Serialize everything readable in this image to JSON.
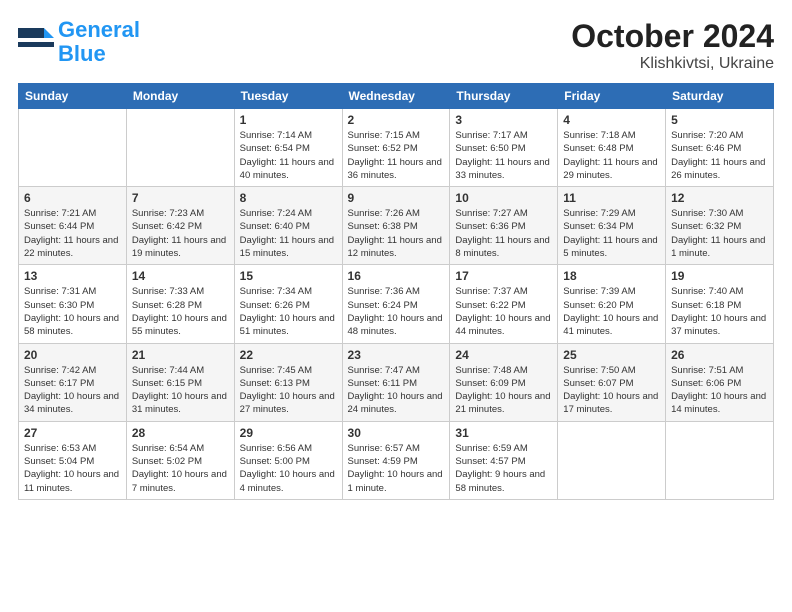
{
  "header": {
    "logo_line1": "General",
    "logo_line2": "Blue",
    "month": "October 2024",
    "location": "Klishkivtsi, Ukraine"
  },
  "weekdays": [
    "Sunday",
    "Monday",
    "Tuesday",
    "Wednesday",
    "Thursday",
    "Friday",
    "Saturday"
  ],
  "weeks": [
    [
      {
        "day": null
      },
      {
        "day": null
      },
      {
        "day": "1",
        "sunrise": "7:14 AM",
        "sunset": "6:54 PM",
        "daylight": "11 hours and 40 minutes."
      },
      {
        "day": "2",
        "sunrise": "7:15 AM",
        "sunset": "6:52 PM",
        "daylight": "11 hours and 36 minutes."
      },
      {
        "day": "3",
        "sunrise": "7:17 AM",
        "sunset": "6:50 PM",
        "daylight": "11 hours and 33 minutes."
      },
      {
        "day": "4",
        "sunrise": "7:18 AM",
        "sunset": "6:48 PM",
        "daylight": "11 hours and 29 minutes."
      },
      {
        "day": "5",
        "sunrise": "7:20 AM",
        "sunset": "6:46 PM",
        "daylight": "11 hours and 26 minutes."
      }
    ],
    [
      {
        "day": "6",
        "sunrise": "7:21 AM",
        "sunset": "6:44 PM",
        "daylight": "11 hours and 22 minutes."
      },
      {
        "day": "7",
        "sunrise": "7:23 AM",
        "sunset": "6:42 PM",
        "daylight": "11 hours and 19 minutes."
      },
      {
        "day": "8",
        "sunrise": "7:24 AM",
        "sunset": "6:40 PM",
        "daylight": "11 hours and 15 minutes."
      },
      {
        "day": "9",
        "sunrise": "7:26 AM",
        "sunset": "6:38 PM",
        "daylight": "11 hours and 12 minutes."
      },
      {
        "day": "10",
        "sunrise": "7:27 AM",
        "sunset": "6:36 PM",
        "daylight": "11 hours and 8 minutes."
      },
      {
        "day": "11",
        "sunrise": "7:29 AM",
        "sunset": "6:34 PM",
        "daylight": "11 hours and 5 minutes."
      },
      {
        "day": "12",
        "sunrise": "7:30 AM",
        "sunset": "6:32 PM",
        "daylight": "11 hours and 1 minute."
      }
    ],
    [
      {
        "day": "13",
        "sunrise": "7:31 AM",
        "sunset": "6:30 PM",
        "daylight": "10 hours and 58 minutes."
      },
      {
        "day": "14",
        "sunrise": "7:33 AM",
        "sunset": "6:28 PM",
        "daylight": "10 hours and 55 minutes."
      },
      {
        "day": "15",
        "sunrise": "7:34 AM",
        "sunset": "6:26 PM",
        "daylight": "10 hours and 51 minutes."
      },
      {
        "day": "16",
        "sunrise": "7:36 AM",
        "sunset": "6:24 PM",
        "daylight": "10 hours and 48 minutes."
      },
      {
        "day": "17",
        "sunrise": "7:37 AM",
        "sunset": "6:22 PM",
        "daylight": "10 hours and 44 minutes."
      },
      {
        "day": "18",
        "sunrise": "7:39 AM",
        "sunset": "6:20 PM",
        "daylight": "10 hours and 41 minutes."
      },
      {
        "day": "19",
        "sunrise": "7:40 AM",
        "sunset": "6:18 PM",
        "daylight": "10 hours and 37 minutes."
      }
    ],
    [
      {
        "day": "20",
        "sunrise": "7:42 AM",
        "sunset": "6:17 PM",
        "daylight": "10 hours and 34 minutes."
      },
      {
        "day": "21",
        "sunrise": "7:44 AM",
        "sunset": "6:15 PM",
        "daylight": "10 hours and 31 minutes."
      },
      {
        "day": "22",
        "sunrise": "7:45 AM",
        "sunset": "6:13 PM",
        "daylight": "10 hours and 27 minutes."
      },
      {
        "day": "23",
        "sunrise": "7:47 AM",
        "sunset": "6:11 PM",
        "daylight": "10 hours and 24 minutes."
      },
      {
        "day": "24",
        "sunrise": "7:48 AM",
        "sunset": "6:09 PM",
        "daylight": "10 hours and 21 minutes."
      },
      {
        "day": "25",
        "sunrise": "7:50 AM",
        "sunset": "6:07 PM",
        "daylight": "10 hours and 17 minutes."
      },
      {
        "day": "26",
        "sunrise": "7:51 AM",
        "sunset": "6:06 PM",
        "daylight": "10 hours and 14 minutes."
      }
    ],
    [
      {
        "day": "27",
        "sunrise": "6:53 AM",
        "sunset": "5:04 PM",
        "daylight": "10 hours and 11 minutes."
      },
      {
        "day": "28",
        "sunrise": "6:54 AM",
        "sunset": "5:02 PM",
        "daylight": "10 hours and 7 minutes."
      },
      {
        "day": "29",
        "sunrise": "6:56 AM",
        "sunset": "5:00 PM",
        "daylight": "10 hours and 4 minutes."
      },
      {
        "day": "30",
        "sunrise": "6:57 AM",
        "sunset": "4:59 PM",
        "daylight": "10 hours and 1 minute."
      },
      {
        "day": "31",
        "sunrise": "6:59 AM",
        "sunset": "4:57 PM",
        "daylight": "9 hours and 58 minutes."
      },
      {
        "day": null
      },
      {
        "day": null
      }
    ]
  ]
}
